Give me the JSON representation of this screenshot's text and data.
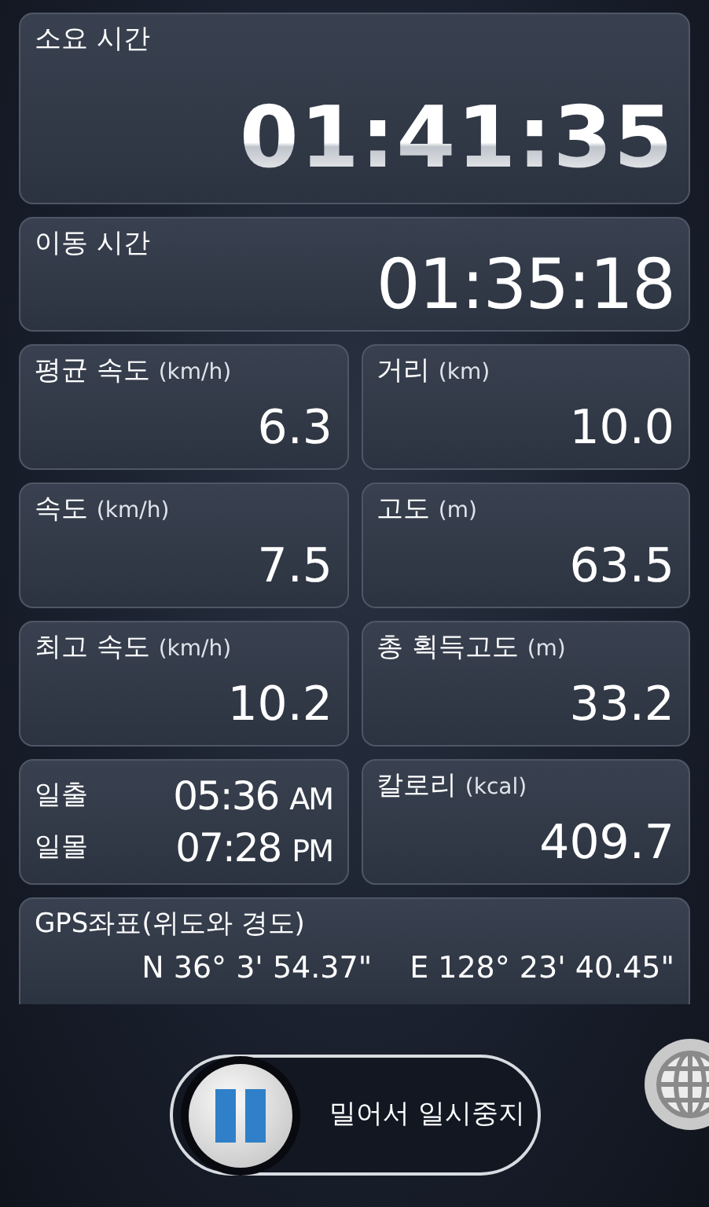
{
  "total_time": {
    "label": "소요 시간",
    "value": "01:41:35"
  },
  "moving_time": {
    "label": "이동 시간",
    "value": "01:35:18"
  },
  "stats": [
    {
      "kind": "stat",
      "label": "평균 속도",
      "unit": "(km/h)",
      "value": "6.3"
    },
    {
      "kind": "stat",
      "label": "거리",
      "unit": "(km)",
      "value": "10.0"
    },
    {
      "kind": "stat",
      "label": "속도",
      "unit": "(km/h)",
      "value": "7.5"
    },
    {
      "kind": "stat",
      "label": "고도",
      "unit": "(m)",
      "value": "63.5"
    },
    {
      "kind": "stat",
      "label": "최고 속도",
      "unit": "(km/h)",
      "value": "10.2"
    },
    {
      "kind": "stat",
      "label": "총 획득고도",
      "unit": "(m)",
      "value": "33.2"
    },
    {
      "kind": "sun",
      "rows": [
        {
          "label": "일출",
          "time": "05:36",
          "ampm": "AM"
        },
        {
          "label": "일몰",
          "time": "07:28",
          "ampm": "PM"
        }
      ]
    },
    {
      "kind": "stat",
      "label": "칼로리",
      "unit": "(kcal)",
      "value": "409.7"
    }
  ],
  "gps": {
    "label": "GPS좌표(위도와 경도)",
    "latitude": "N 36° 3' 54.37\"",
    "longitude": "E 128° 23' 40.45\""
  },
  "pause_slider": {
    "label": "밀어서 일시중지"
  }
}
